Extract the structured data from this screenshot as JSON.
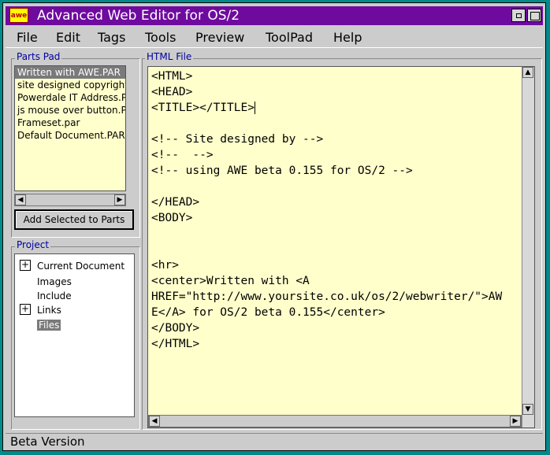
{
  "window": {
    "title": "Advanced Web Editor for OS/2",
    "icon": "awe-logo-icon",
    "logo_text": "awe"
  },
  "menu": {
    "items": [
      {
        "label": "File"
      },
      {
        "label": "Edit"
      },
      {
        "label": "Tags"
      },
      {
        "label": "Tools"
      },
      {
        "label": "Preview"
      },
      {
        "label": "ToolPad"
      },
      {
        "label": "Help"
      }
    ]
  },
  "parts_pad": {
    "label": "Parts Pad",
    "items": [
      "Written with AWE.PAR",
      "site designed copyright.PAR",
      "Powerdale IT Address.PAR",
      "js mouse over button.PAR",
      "Frameset.par",
      "Default Document.PAR"
    ],
    "selected_index": 0,
    "add_button": "Add Selected to Parts"
  },
  "project": {
    "label": "Project",
    "nodes": [
      {
        "label": "Current Document",
        "expandable": true
      },
      {
        "label": "Images",
        "expandable": false
      },
      {
        "label": "Include",
        "expandable": false
      },
      {
        "label": "Links",
        "expandable": true
      },
      {
        "label": "Files",
        "expandable": false,
        "selected": true
      }
    ]
  },
  "editor": {
    "label": "HTML File",
    "lines": [
      "<HTML>",
      "<HEAD>",
      "<TITLE></TITLE>",
      "",
      "<!-- Site designed by -->",
      "<!--  -->",
      "<!-- using AWE beta 0.155 for OS/2 -->",
      "",
      "</HEAD>",
      "<BODY>",
      "",
      "",
      "<hr>",
      "<center>Written with <A",
      "HREF=\"http://www.yoursite.co.uk/os/2/webwriter/\">AW",
      "E</A> for OS/2 beta 0.155</center>",
      "</BODY>",
      "</HTML>"
    ]
  },
  "status": {
    "text": "Beta Version"
  },
  "colors": {
    "titlebar": "#6f0a9f",
    "desktop": "#008a8a",
    "editor_bg": "#ffffcc",
    "group_label": "#0000a0"
  }
}
